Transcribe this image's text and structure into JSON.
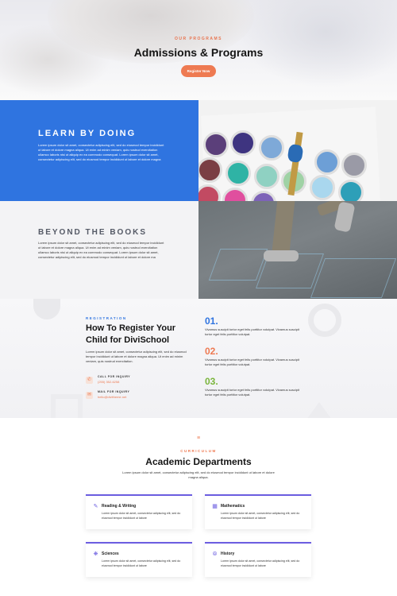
{
  "hero": {
    "kicker": "OUR PROGRAMS",
    "title": "Admissions & Programs",
    "button_label": "Register Now"
  },
  "learn": {
    "title": "LEARN BY DOING",
    "body": "Lorem ipsum dolor sit amet, consectetur adipiscing elit, sed do eiusmod tempor incididunt ut labore et dolore magna aliqua. Ut enim ad minim veniam, quis nostrud exercitation ullamco laboris nisi ut aliquip ex ea commodo consequat. Lorem ipsum dolor sit amet, consectetur adipiscing elit, sed do eiusmod tempor incididunt ut labore et dolore magna"
  },
  "beyond": {
    "title": "BEYOND THE BOOKS",
    "body": "Lorem ipsum dolor sit amet, consectetur adipiscing elit, sed do eiusmod tempor incididunt ut labore et dolore magna aliqua. Ut enim ad minim veniam, quis nostrud exercitation ullamco laboris nisi ut aliquip ex ea commodo consequat. Lorem ipsum dolor sit amet, consectetur adipiscing elit, sed do eiusmod tempor incididunt ut labore et dolore ma"
  },
  "register": {
    "kicker": "REGISTRATION",
    "title": "How To Register Your Child for DiviSchool",
    "body": "Lorem ipsum dolor sit amet, consectetur adipiscing elit, sed do eiusmod tempor incididunt ut labore et dolore magna aliqua. Ut enim ad minim veniam, quis nostrud exercitation.",
    "contacts": [
      {
        "label": "CALL FOR INQUIRY",
        "value": "(255) 352-6258",
        "icon": "phone-icon"
      },
      {
        "label": "MAIL FOR INQUIRY",
        "value": "hello@divitheme.net",
        "icon": "mail-icon"
      }
    ],
    "steps": [
      {
        "num": "01.",
        "color": "#2f74e0",
        "text": "Vivamus suscipit tortor eget felis porttitor volutpat. Vivamus suscipit tortor eget felis porttitor volutpat."
      },
      {
        "num": "02.",
        "color": "#ee7a52",
        "text": "Vivamus suscipit tortor eget felis porttitor volutpat. Vivamus suscipit tortor eget felis porttitor volutpat."
      },
      {
        "num": "03.",
        "color": "#7ab53c",
        "text": "Vivamus suscipit tortor eget felis porttitor volutpat. Vivamus suscipit tortor eget felis porttitor volutpat."
      }
    ]
  },
  "departments": {
    "kicker": "CURRICULUM",
    "title": "Academic Departments",
    "body": "Lorem ipsum dolor sit amet, consectetur adipiscing elit, sed do eiusmod tempor incididunt ut labore et dolore magna aliqua.",
    "cards": [
      {
        "title": "Reading & Writing",
        "icon": "book-pen-icon",
        "text": "Lorem ipsum dolor sit amet, consectetur adipiscing elit, sed do eiusmod tempor incididunt ut labore"
      },
      {
        "title": "Mathematics",
        "icon": "calculator-icon",
        "text": "Lorem ipsum dolor sit amet, consectetur adipiscing elit, sed do eiusmod tempor incididunt ut labore"
      },
      {
        "title": "Sciences",
        "icon": "atom-icon",
        "text": "Lorem ipsum dolor sit amet, consectetur adipiscing elit, sed do eiusmod tempor incididunt ut labore"
      },
      {
        "title": "History",
        "icon": "compass-icon",
        "text": "Lorem ipsum dolor sit amet, consectetur adipiscing elit, sed do eiusmod tempor incididunt ut labore"
      }
    ]
  },
  "colors": {
    "accent_orange": "#ee7a52",
    "accent_blue": "#2f74e0",
    "accent_green": "#7ab53c",
    "accent_purple": "#6b5de0"
  }
}
